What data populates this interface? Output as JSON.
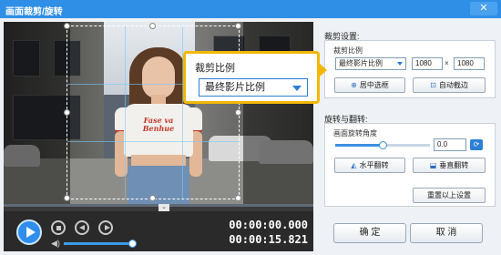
{
  "window": {
    "title": "画面裁剪/旋转",
    "close_label": "✕"
  },
  "crop": {
    "section_label": "裁剪设置:",
    "ratio_label": "裁剪比例",
    "ratio_value": "最终影片比例",
    "width": "1080",
    "height": "1080",
    "times_sign": "×",
    "center_button": "居中选框",
    "auto_border_button": "自动截边"
  },
  "callout": {
    "label": "裁剪比例",
    "value": "最终影片比例"
  },
  "rotate": {
    "section_label": "旋转与翻转:",
    "angle_label": "画面旋转角度",
    "angle_value": "0.0",
    "angle_fraction": 0.5,
    "flip_h_button": "水平翻转",
    "flip_v_button": "垂直翻转",
    "reset_button": "重置以上设置"
  },
  "player": {
    "current_time": "00:00:00.000",
    "total_time": "00:00:15.821",
    "volume_fraction": 1.0
  },
  "shirt_text": "Fase va Benhue",
  "footer": {
    "ok_button": "确 定",
    "cancel_button": "取 消"
  },
  "colors": {
    "accent": "#2e8ded",
    "callout_border": "#f2b705"
  }
}
